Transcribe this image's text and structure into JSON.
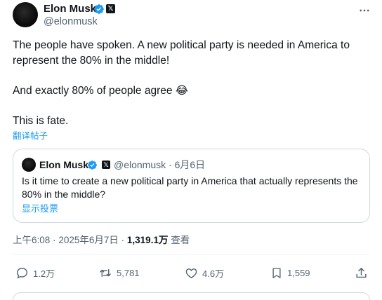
{
  "author": {
    "name": "Elon Musk",
    "handle": "@elonmusk",
    "verified_icon": "verified-badge-icon",
    "affiliate_icon": "x-logo-icon",
    "more_icon": "more-horizontal-icon"
  },
  "tweet": {
    "paragraph_1": "The people have spoken. A new political party is needed in America to represent the 80% in the middle!",
    "paragraph_2": "And exactly 80% of people agree 😂",
    "paragraph_3": "This is fate.",
    "translate_label": "翻译帖子"
  },
  "quote": {
    "name": "Elon Musk",
    "handle": "@elonmusk",
    "separator": "·",
    "date": "6月6日",
    "text": "Is it time to create a new political party in America that actually represents the 80% in the middle?",
    "show_poll_label": "显示投票"
  },
  "meta": {
    "time": "上午6:08",
    "separator": "·",
    "date": "2025年6月7日",
    "separator2": "·",
    "views_count": "1,319.1万",
    "views_label": "查看"
  },
  "actions": {
    "replies": "1.2万",
    "retweets": "5,781",
    "likes": "4.6万",
    "bookmarks": "1,559"
  },
  "colors": {
    "accent": "#1d9bf0",
    "text": "#0f1419",
    "muted": "#536471",
    "border": "#cfd9de"
  }
}
